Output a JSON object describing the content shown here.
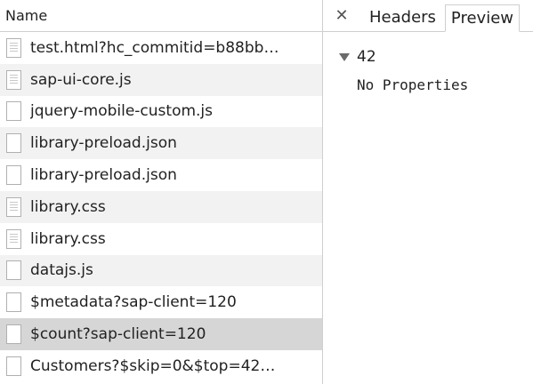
{
  "requests": {
    "column_name": "Name",
    "items": [
      {
        "label": "test.html?hc_commitid=b88bb…",
        "icon": "document-icon"
      },
      {
        "label": "sap-ui-core.js",
        "icon": "document-icon"
      },
      {
        "label": "jquery-mobile-custom.js",
        "icon": "file-icon"
      },
      {
        "label": "library-preload.json",
        "icon": "file-icon"
      },
      {
        "label": "library-preload.json",
        "icon": "file-icon"
      },
      {
        "label": "library.css",
        "icon": "document-icon"
      },
      {
        "label": "library.css",
        "icon": "document-icon"
      },
      {
        "label": "datajs.js",
        "icon": "file-icon"
      },
      {
        "label": "$metadata?sap-client=120",
        "icon": "file-icon"
      },
      {
        "label": "$count?sap-client=120",
        "icon": "file-icon",
        "selected": true
      },
      {
        "label": "Customers?$skip=0&$top=42…",
        "icon": "file-icon"
      }
    ]
  },
  "details": {
    "close_glyph": "✕",
    "tabs": [
      {
        "label": "Headers",
        "active": false
      },
      {
        "label": "Preview",
        "active": true
      }
    ],
    "preview": {
      "root_value": "42",
      "empty_text": "No Properties"
    }
  },
  "colors": {
    "stripe": "#f2f2f2",
    "selected": "#d6d6d6",
    "border": "#cfcfcf"
  }
}
